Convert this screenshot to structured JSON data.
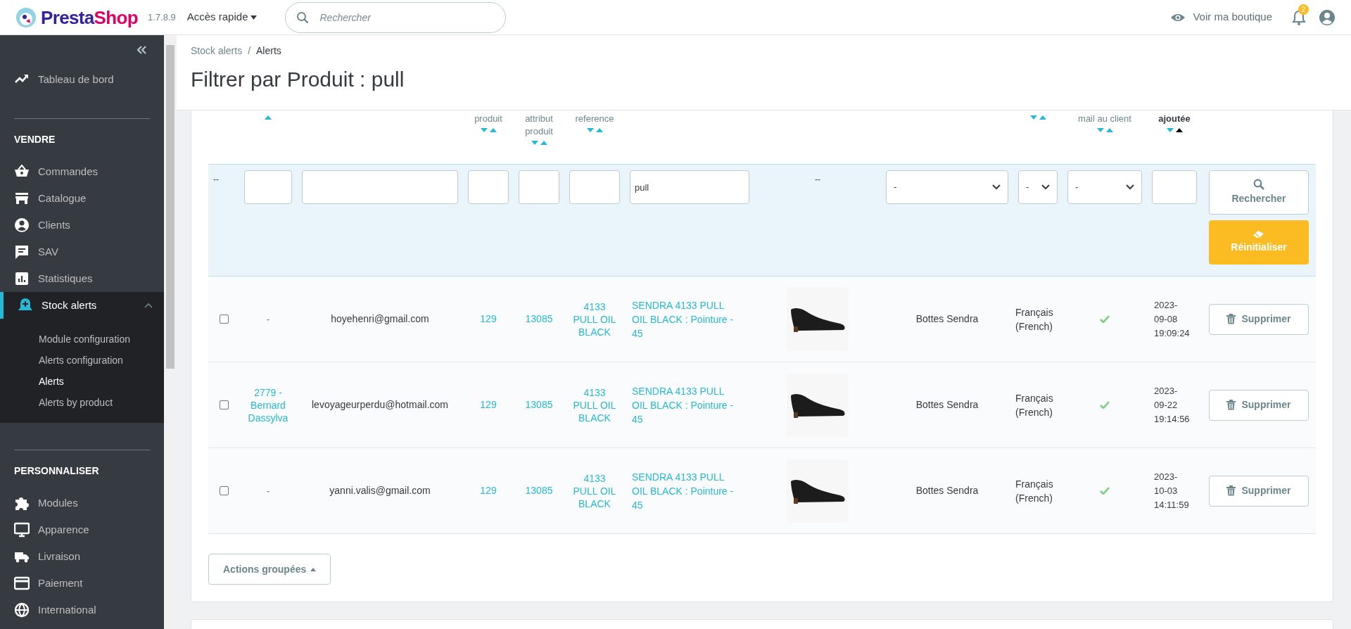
{
  "topbar": {
    "logo_parts": [
      "Presta",
      "Shop"
    ],
    "version": "1.7.8.9",
    "quick_access": "Accès rapide",
    "search": {
      "placeholder": "Rechercher"
    },
    "shop_link": "Voir ma boutique",
    "notifications_count": "2"
  },
  "sidebar": {
    "sections": [
      {
        "items": [
          {
            "label": "Tableau de bord",
            "selected": false
          }
        ]
      },
      {
        "title": "VENDRE",
        "items": [
          {
            "label": "Commandes",
            "selected": false
          },
          {
            "label": "Catalogue",
            "selected": false
          },
          {
            "label": "Clients",
            "selected": false
          },
          {
            "label": "SAV",
            "selected": false
          },
          {
            "label": "Statistiques",
            "selected": false
          },
          {
            "label": "Stock alerts",
            "selected": true,
            "expanded": true,
            "children": [
              {
                "label": "Module configuration",
                "selected": false
              },
              {
                "label": "Alerts configuration",
                "selected": false
              },
              {
                "label": "Alerts",
                "selected": true
              },
              {
                "label": "Alerts by product",
                "selected": false
              }
            ]
          }
        ]
      },
      {
        "title": "PERSONNALISER",
        "items": [
          {
            "label": "Modules",
            "selected": false
          },
          {
            "label": "Apparence",
            "selected": false
          },
          {
            "label": "Livraison",
            "selected": false
          },
          {
            "label": "Paiement",
            "selected": false
          },
          {
            "label": "International",
            "selected": false
          }
        ]
      }
    ]
  },
  "breadcrumb": {
    "items": [
      "Stock alerts",
      "Alerts"
    ],
    "separator": "/"
  },
  "page_title": "Filtrer par Produit : pull",
  "table": {
    "columns": [
      {
        "sort_desc": false,
        "sort_asc": false
      },
      {
        "sort_desc": false,
        "sort_asc": true,
        "sorted": false
      },
      {
        "sort_desc": false,
        "sort_asc": false
      },
      {
        "label": "produit",
        "sort_desc": true,
        "sort_asc": true,
        "sorted": false
      },
      {
        "label": "attribut produit",
        "sort_desc": true,
        "sort_asc": true,
        "sorted": false
      },
      {
        "label": "reference",
        "sort_desc": true,
        "sort_asc": true,
        "sorted": false
      },
      {
        "sort_desc": false,
        "sort_asc": false
      },
      {
        "sort_desc": false,
        "sort_asc": false
      },
      {
        "sort_desc": false,
        "sort_asc": false
      },
      {
        "sort_desc": true,
        "sort_asc": true,
        "sorted": false
      },
      {
        "label": "mail au client",
        "sort_desc": true,
        "sort_asc": true,
        "sorted": false
      },
      {
        "label": "ajoutée",
        "sort_desc": true,
        "sort_asc": true,
        "sorted": true
      },
      {
        "sort_desc": false,
        "sort_asc": false
      }
    ],
    "filters": [
      {
        "kind": "text",
        "value": "--"
      },
      {
        "kind": "input"
      },
      {
        "kind": "input"
      },
      {
        "kind": "input"
      },
      {
        "kind": "input"
      },
      {
        "kind": "input"
      },
      {
        "kind": "input",
        "value": "pull"
      },
      {
        "kind": "text",
        "value": "--"
      },
      {
        "kind": "select",
        "value": "-"
      },
      {
        "kind": "select",
        "value": "-"
      },
      {
        "kind": "select",
        "value": "-"
      },
      {
        "kind": "input"
      },
      {
        "kind": "buttons",
        "search": "Rechercher",
        "reset": "Réinitialiser"
      }
    ],
    "rows": [
      {
        "checked": false,
        "customer": "-",
        "customer_link": false,
        "email": "hoyehenri@gmail.com",
        "product_id": "129",
        "attribute_id": "13085",
        "reference": "4133 PULL OIL BLACK",
        "product_name": "SENDRA 4133 PULL OIL BLACK : Pointure - 45",
        "shop": "Bottes Sendra",
        "language": "Français (French)",
        "mail_sent": true,
        "date": "2023-09-08 19:09:24",
        "action": "Supprimer"
      },
      {
        "checked": false,
        "customer": "2779 - Bernard Dassylva",
        "customer_link": true,
        "email": "levoyageurperdu@hotmail.com",
        "product_id": "129",
        "attribute_id": "13085",
        "reference": "4133 PULL OIL BLACK",
        "product_name": "SENDRA 4133 PULL OIL BLACK : Pointure - 45",
        "shop": "Bottes Sendra",
        "language": "Français (French)",
        "mail_sent": true,
        "date": "2023-09-22 19:14:56",
        "action": "Supprimer"
      },
      {
        "checked": false,
        "customer": "-",
        "customer_link": false,
        "email": "yanni.valis@gmail.com",
        "product_id": "129",
        "attribute_id": "13085",
        "reference": "4133 PULL OIL BLACK",
        "product_name": "SENDRA 4133 PULL OIL BLACK : Pointure - 45",
        "shop": "Bottes Sendra",
        "language": "Français (French)",
        "mail_sent": true,
        "date": "2023-10-03 14:11:59",
        "action": "Supprimer"
      }
    ],
    "bulk_actions": "Actions groupées"
  }
}
